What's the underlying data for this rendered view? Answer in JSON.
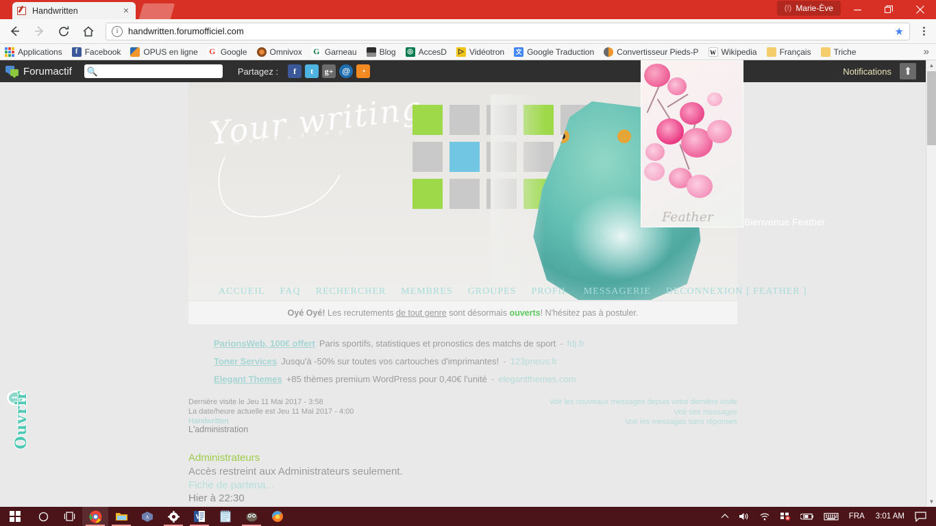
{
  "browser": {
    "tab": {
      "title": "Handwritten",
      "favicon": "handwritten-favicon",
      "close": "×"
    },
    "profile": {
      "icon": "warning-icon",
      "name": "Marie-Ève"
    },
    "window_controls": {
      "minimize": "minimize-icon",
      "maximize": "maximize-icon",
      "close": "close-icon"
    },
    "toolbar": {
      "back": "←",
      "forward": "→",
      "reload": "⟳",
      "home": "⌂",
      "info_icon": "i",
      "url": "handwritten.forumofficiel.com",
      "star": "★",
      "menu": "kebab-menu-icon"
    },
    "bookmarks": [
      {
        "label": "Applications",
        "icon": "apps-grid"
      },
      {
        "label": "Facebook",
        "icon": "f",
        "color": "#3b5998"
      },
      {
        "label": "OPUS en ligne",
        "icon": "opus",
        "color": "#e8872b"
      },
      {
        "label": "Google",
        "icon": "G",
        "color": "#ffffff"
      },
      {
        "label": "Omnivox",
        "icon": "omnivox",
        "color": "#d9731a"
      },
      {
        "label": "Garneau",
        "icon": "G",
        "color": "#1a7a46"
      },
      {
        "label": "Blog",
        "icon": "blog",
        "color": "#555555"
      },
      {
        "label": "AccesD",
        "icon": "accesd",
        "color": "#0a7a4f"
      },
      {
        "label": "Vidéotron",
        "icon": "videotron",
        "color": "#f0c419"
      },
      {
        "label": "Google Traduction",
        "icon": "G",
        "color": "#4285f4"
      },
      {
        "label": "Convertisseur Pieds-P",
        "icon": "convert",
        "color": "#3a7bbf"
      },
      {
        "label": "Wikipedia",
        "icon": "W",
        "color": "#ffffff"
      },
      {
        "label": "Français",
        "icon": "folder",
        "color": "#f5cd6b"
      },
      {
        "label": "Triche",
        "icon": "folder",
        "color": "#f5cd6b"
      }
    ],
    "bookmarks_overflow": "»"
  },
  "forumactif_bar": {
    "brand": "Forumactif",
    "search_placeholder": "",
    "search_value": "",
    "share_label": "Partagez :",
    "socials": [
      {
        "name": "facebook-share",
        "glyph": "f"
      },
      {
        "name": "twitter-share",
        "glyph": "t"
      },
      {
        "name": "googleplus-share",
        "glyph": "g+"
      },
      {
        "name": "email-share",
        "glyph": "@"
      },
      {
        "name": "rss-share",
        "glyph": "◔"
      }
    ],
    "notifications_label": "Notifications",
    "notifications_button": "⬆"
  },
  "banner": {
    "title_script": "Your writing",
    "subtitle": "m y   r e a d i n g",
    "tiles": [
      [
        "#9ed94a",
        "#c9c9c9",
        "#c9c9c9",
        "#9ed94a",
        "#c9c9c9"
      ],
      [
        "#c9c9c9",
        "#71c7e3",
        "#c9c9c9",
        "#c9c9c9",
        "#71c7e3"
      ],
      [
        "#9ed94a",
        "#c9c9c9",
        "#c9c9c9",
        "#a5dc5c",
        "#c9c9c9"
      ]
    ],
    "artwork": "owl-illustration"
  },
  "floating_image": {
    "name": "feather-flowers-image",
    "signature": "Feather",
    "welcome_text": "Bienvenue Feather"
  },
  "nav": {
    "items": [
      "ACCUEIL",
      "FAQ",
      "RECHERCHER",
      "MEMBRES",
      "GROUPES",
      "PROFIL",
      "MESSAGERIE",
      "DECONNEXION [ FEATHER ]"
    ]
  },
  "announcement": {
    "lead": "Oyé Oyé!",
    "part1": " Les recrutements ",
    "link": "de tout genre",
    "part2": " sont désormais ",
    "highlight": "ouverts",
    "part3": "! N'hésitez pas à postuler."
  },
  "ads": [
    {
      "title": "ParionsWeb, 100€ offert",
      "text": "Paris sportifs, statistiques et pronostics des matchs de sport",
      "sep": "-",
      "domain": "fdj.fr"
    },
    {
      "title": "Toner Services",
      "text": "Jusqu'à -50% sur toutes vos cartouches d'imprimantes!",
      "sep": "-",
      "domain": "123pneus.fr"
    },
    {
      "title": "Elegant Themes",
      "text": "+85 thèmes premium WordPress pour 0,40€ l'unité",
      "sep": "-",
      "domain": "elegantthemes.com"
    }
  ],
  "visit_info": {
    "last_visit": "Dernière visite le Jeu 11 Mai 2017 - 3:58",
    "current_time": "La date/heure actuelle est Jeu 11 Mai 2017 - 4:00",
    "forum_name": "Handwritten",
    "links": [
      "Voir les nouveaux messages depuis votre dernière visite",
      "Voir ses messages",
      "Voir les messages sans réponses"
    ]
  },
  "admin_section": {
    "heading": "L'administration",
    "category": {
      "title": "Administrateurs",
      "description": "Accès restreint aux Administrateurs seulement.",
      "last_topic": "Fiche de partena...",
      "last_time": "Hier à 22:30"
    }
  },
  "side_tab": {
    "label": "Ouvrir",
    "icon": "dots-circle-icon"
  },
  "scrollbar": {
    "up": "▲",
    "down": "▼"
  },
  "taskbar": {
    "start": "windows-logo",
    "items": [
      {
        "name": "cortana-search-icon",
        "glyph": "○",
        "active": false
      },
      {
        "name": "task-view-icon",
        "glyph": "❐",
        "active": false
      },
      {
        "name": "chrome-taskbar-icon",
        "glyph": "chrome",
        "active": true
      },
      {
        "name": "file-explorer-icon",
        "glyph": "folder",
        "active": false
      },
      {
        "name": "antidote-icon",
        "glyph": "antidote",
        "active": false
      },
      {
        "name": "settings-icon",
        "glyph": "⚙",
        "active": false
      },
      {
        "name": "word-icon",
        "glyph": "W",
        "active": false
      },
      {
        "name": "notepad-icon",
        "glyph": "notepad",
        "active": false
      },
      {
        "name": "gimp-icon",
        "glyph": "gimp",
        "active": false
      },
      {
        "name": "firefox-icon",
        "glyph": "firefox",
        "active": false
      }
    ],
    "tray": {
      "chevron": "⌃",
      "volume": "volume-icon",
      "wifi": "wifi-icon",
      "network": "network-error-icon",
      "battery": "battery-charging-icon",
      "keyboard": "keyboard-icon",
      "language": "FRA",
      "clock": "3:01 AM",
      "action_center": "action-center-icon"
    }
  },
  "colors": {
    "chrome_red": "#d93025",
    "taskbar": "#4a1418",
    "forum_accent": "#a8dcd9",
    "category_green": "#9ccc4a",
    "tile_green": "#9ed94a",
    "tile_blue": "#71c7e3"
  }
}
